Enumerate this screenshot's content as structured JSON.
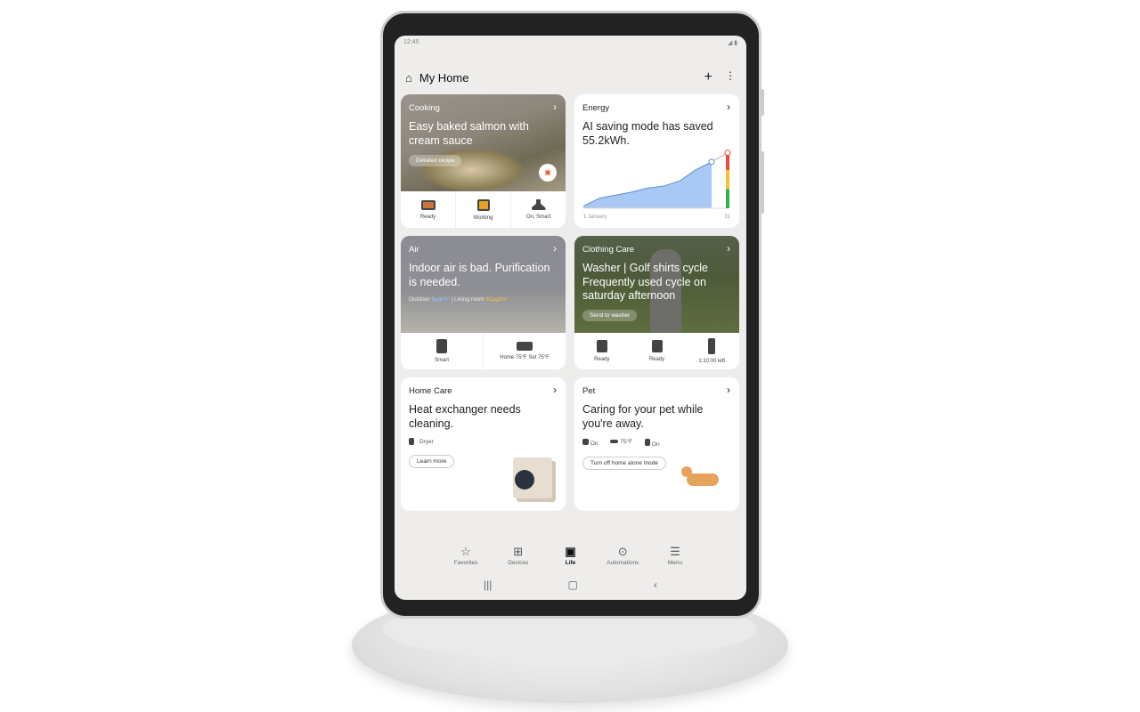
{
  "status": {
    "time": "12:45",
    "icons": [
      "signal-icon",
      "battery-icon"
    ]
  },
  "header": {
    "title": "My Home",
    "icon": "home-icon",
    "add": "+",
    "more": "⋮"
  },
  "cards": {
    "cooking": {
      "category": "Cooking",
      "headline": "Easy baked salmon with cream sauce",
      "button": "Detailed recipe",
      "devices": [
        {
          "status": "Ready",
          "icon": "oven-icon"
        },
        {
          "status": "Working",
          "icon": "cooktop-icon"
        },
        {
          "status": "On, Smart",
          "icon": "hood-icon"
        }
      ]
    },
    "energy": {
      "category": "Energy",
      "headline": "AI saving mode has saved 55.2kWh.",
      "x_start": "1 January",
      "x_end": "31"
    },
    "air": {
      "category": "Air",
      "headline": "Indoor air is bad. Purification is needed.",
      "outdoor_label": "Outdoor",
      "outdoor_value": "5μg/m³",
      "living_label": "Living room",
      "living_value": "81μg/m³",
      "devices": [
        {
          "status": "Smart",
          "icon": "air-purifier-icon"
        },
        {
          "status": "Home 75°F Set 75°F",
          "icon": "air-conditioner-icon"
        }
      ]
    },
    "clothing": {
      "category": "Clothing Care",
      "headline": "Washer | Golf shirts cycle Frequently used cycle on saturday afternoon",
      "button": "Send to washer",
      "devices": [
        {
          "status": "Ready",
          "icon": "washer-icon"
        },
        {
          "status": "Ready",
          "icon": "dryer-icon"
        },
        {
          "status": "1:10:00 left",
          "icon": "styler-icon"
        }
      ]
    },
    "homecare": {
      "category": "Home Care",
      "headline": "Heat exchanger needs cleaning.",
      "device": "Dryer",
      "button": "Learn more"
    },
    "pet": {
      "category": "Pet",
      "headline": "Caring for your pet while you're away.",
      "items": [
        {
          "icon": "camera-icon",
          "value": "On"
        },
        {
          "icon": "ac-icon",
          "value": "75°F"
        },
        {
          "icon": "purifier-icon",
          "value": "On"
        }
      ],
      "button": "Turn off home alone mode"
    }
  },
  "chart_data": {
    "type": "area",
    "x_labels": [
      "1 January",
      "31"
    ],
    "actual": [
      2,
      10,
      13,
      16,
      20,
      22,
      27,
      38,
      46
    ],
    "projected": [
      46,
      55
    ],
    "level_colors": [
      "#e94b3c",
      "#f2c230",
      "#2fb24c"
    ],
    "fill": "#a9c8f3"
  },
  "nav": {
    "items": [
      {
        "label": "Favorites",
        "icon": "☆"
      },
      {
        "label": "Devices",
        "icon": "⊞"
      },
      {
        "label": "Life",
        "icon": "▣"
      },
      {
        "label": "Automations",
        "icon": "⊙"
      },
      {
        "label": "Menu",
        "icon": "☰"
      }
    ],
    "active": "Life"
  },
  "sysnav": {
    "recent": "|||",
    "home": "▢",
    "back": "‹"
  }
}
